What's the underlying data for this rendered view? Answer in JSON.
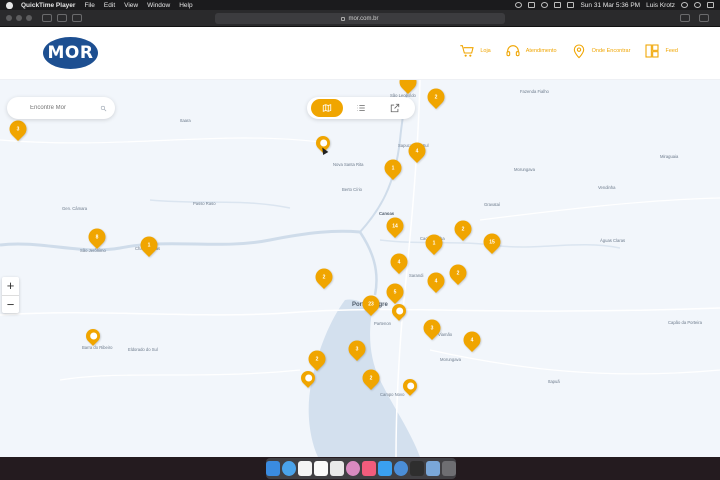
{
  "menubar": {
    "app": "QuickTime Player",
    "items": [
      "File",
      "Edit",
      "View",
      "Window",
      "Help"
    ],
    "clock": "Sun 31 Mar  5:36 PM",
    "user": "Luis Krotz"
  },
  "browser": {
    "url": "mor.com.br"
  },
  "header": {
    "logo": "MOR",
    "nav": [
      {
        "label": "Loja",
        "icon": "cart-icon"
      },
      {
        "label": "Atendimento",
        "icon": "headset-icon"
      },
      {
        "label": "Onde Encontrar",
        "icon": "location-pin-icon"
      },
      {
        "label": "Feed",
        "icon": "feed-icon"
      }
    ]
  },
  "map": {
    "search_placeholder": "Encontre Mor",
    "zoom_in": "+",
    "zoom_out": "−",
    "places": [
      {
        "name": "São Leopoldo"
      },
      {
        "name": "Fazenda Fialho"
      },
      {
        "name": "Itaara"
      },
      {
        "name": "Sapucaia do Sul"
      },
      {
        "name": "Nova Santa Rita"
      },
      {
        "name": "Morungava"
      },
      {
        "name": "Miraguaia"
      },
      {
        "name": "Berto Círio"
      },
      {
        "name": "Gen. Câmara"
      },
      {
        "name": "Passo Raso"
      },
      {
        "name": "Vendinha"
      },
      {
        "name": "Canoas"
      },
      {
        "name": "Gravataí"
      },
      {
        "name": "Cachoeirinha"
      },
      {
        "name": "Águas Claras"
      },
      {
        "name": "São Jerônimo"
      },
      {
        "name": "Charqueadas"
      },
      {
        "name": "Sarandi"
      },
      {
        "name": "Porto Alegre"
      },
      {
        "name": "Partenon"
      },
      {
        "name": "Viamão"
      },
      {
        "name": "Morungava"
      },
      {
        "name": "Eldorado do Sul"
      },
      {
        "name": "Barra do Ribeiro"
      },
      {
        "name": "Campo Novo"
      },
      {
        "name": "Itapuã"
      },
      {
        "name": "Capão da Porteira"
      }
    ],
    "pins": [
      {
        "label": ""
      },
      {
        "label": "2"
      },
      {
        "label": "3"
      },
      {
        "label": ""
      },
      {
        "label": "4"
      },
      {
        "label": "1"
      },
      {
        "label": "8"
      },
      {
        "label": "1"
      },
      {
        "label": "14"
      },
      {
        "label": "2"
      },
      {
        "label": "1"
      },
      {
        "label": "15"
      },
      {
        "label": "4"
      },
      {
        "label": "2"
      },
      {
        "label": "2"
      },
      {
        "label": "4"
      },
      {
        "label": "5"
      },
      {
        "label": "23"
      },
      {
        "label": ""
      },
      {
        "label": "3"
      },
      {
        "label": "4"
      },
      {
        "label": "3"
      },
      {
        "label": "2"
      },
      {
        "label": ""
      },
      {
        "label": "2"
      },
      {
        "label": ""
      },
      {
        "label": ""
      }
    ]
  },
  "colors": {
    "brand_blue": "#1d4f91",
    "accent_orange": "#f0a500",
    "map_bg": "#f2f6fb",
    "water": "#cfdcea"
  }
}
